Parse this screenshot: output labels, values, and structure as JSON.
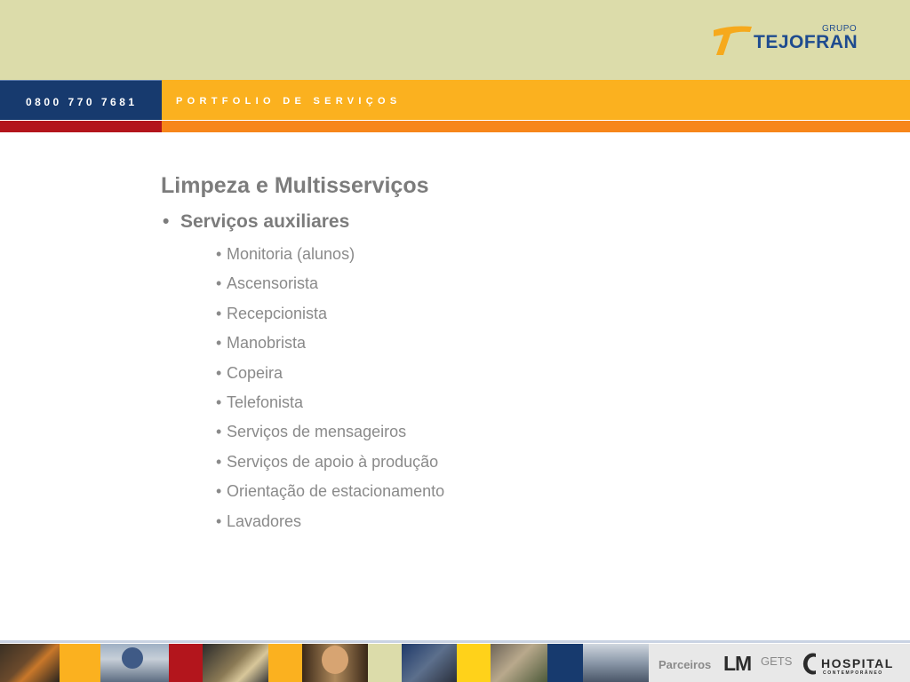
{
  "header": {
    "logo_group": "GRUPO",
    "logo_name": "TEJOFRAN",
    "phone": "0800 770 7681",
    "section_title": "PORTFOLIO DE SERVIÇOS"
  },
  "content": {
    "title": "Limpeza e Multisserviços",
    "section": {
      "bullet": "•",
      "label": "Serviços auxiliares",
      "items": [
        "Monitoria (alunos)",
        "Ascensorista",
        "Recepcionista",
        "Manobrista",
        "Copeira",
        "Telefonista",
        "Serviços de mensageiros",
        "Serviços de apoio à produção",
        "Orientação de estacionamento",
        "Lavadores"
      ]
    }
  },
  "footer": {
    "partners_label": "Parceiros",
    "partner_lm": "LM",
    "partner_gets": "GETS",
    "partner_hospital": "HOSPITAL",
    "partner_hospital_sub": "CONTEMPORÂNEO"
  },
  "colors": {
    "header_beige": "#dcdcaa",
    "navy": "#173a6e",
    "amber": "#fbb11f",
    "red": "#b3151c",
    "orange": "#f7861a",
    "text_gray": "#7c7c7c"
  }
}
